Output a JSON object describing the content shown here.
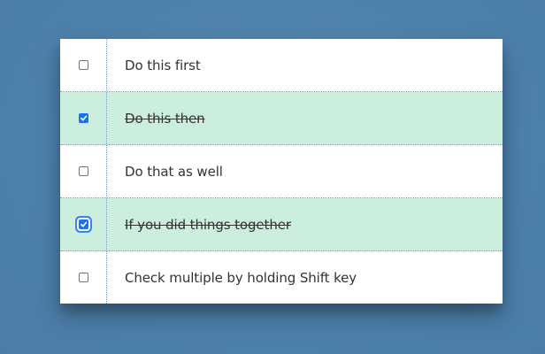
{
  "list": {
    "items": [
      {
        "label": "Do this first",
        "checked": false,
        "focused": false
      },
      {
        "label": "Do this then",
        "checked": true,
        "focused": false
      },
      {
        "label": "Do that as well",
        "checked": false,
        "focused": false
      },
      {
        "label": "If you did things together",
        "checked": true,
        "focused": true
      },
      {
        "label": "Check multiple by holding Shift key",
        "checked": false,
        "focused": false
      }
    ]
  },
  "colors": {
    "background": "#5081ad",
    "checked_row": "#cceedd",
    "checkbox_accent": "#1a73e8",
    "divider": "#7d9fbb"
  },
  "icons": {
    "checkmark": "check-icon"
  }
}
